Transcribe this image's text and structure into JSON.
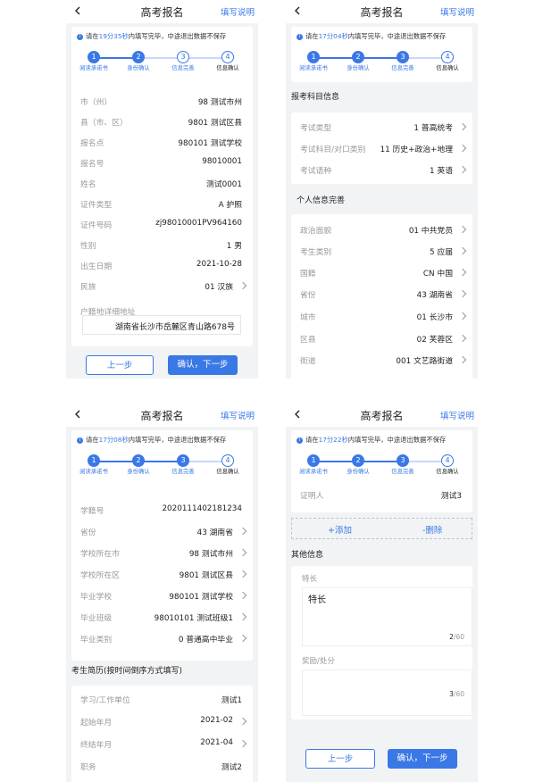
{
  "common": {
    "title": "高考报名",
    "help_link": "填写说明",
    "notice_prefix": "请在",
    "notice_suffix": "内填写完毕，中途退出数据不保存",
    "step_labels": [
      "阅读承诺书",
      "身份确认",
      "信息完善",
      "信息确认"
    ],
    "step_numbers": [
      "1",
      "2",
      "3",
      "4"
    ],
    "prev_button": "上一步",
    "next_button": "确认，下一步",
    "accent_color": "#3a78e6"
  },
  "screen1": {
    "timer": "19分35秒",
    "current_step": 2,
    "rows": [
      {
        "label": "市（州）",
        "value": "98 测试市州"
      },
      {
        "label": "县（市、区）",
        "value": "9801 测试区县"
      },
      {
        "label": "报名点",
        "value": "980101 测试学校"
      },
      {
        "label": "报名号",
        "value": "98010001"
      },
      {
        "label": "姓名",
        "value": "测试0001"
      },
      {
        "label": "证件类型",
        "value": "A 护照"
      },
      {
        "label": "证件号码",
        "value": "zj98010001PV964160"
      },
      {
        "label": "性别",
        "value": "1 男"
      },
      {
        "label": "出生日期",
        "value": "2021-10-28"
      },
      {
        "label": "民族",
        "value": "01 汉族"
      }
    ],
    "address_label": "户籍地详细地址",
    "address_value": "湖南省长沙市岳麓区青山路678号"
  },
  "screen2": {
    "timer": "17分04秒",
    "current_step": 3,
    "section_subjects": "报考科目信息",
    "subject_rows": [
      {
        "label": "考试类型",
        "value": "1 普高统考"
      },
      {
        "label": "考试科目/对口类别",
        "value": "11 历史+政治+地理"
      },
      {
        "label": "考试语种",
        "value": "1 英语"
      }
    ],
    "section_personal": "个人信息完善",
    "personal_rows": [
      {
        "label": "政治面貌",
        "value": "01 中共党员"
      },
      {
        "label": "考生类别",
        "value": "5 应届"
      },
      {
        "label": "国籍",
        "value": "CN 中国"
      },
      {
        "label": "省份",
        "value": "43 湖南省"
      },
      {
        "label": "城市",
        "value": "01 长沙市"
      },
      {
        "label": "区县",
        "value": "02 芙蓉区"
      },
      {
        "label": "街道",
        "value": "001 文艺路街道"
      }
    ]
  },
  "screen3": {
    "timer": "17分08秒",
    "current_step": 3,
    "rows": [
      {
        "label": "学籍号",
        "value": "2020111402181234"
      },
      {
        "label": "省份",
        "value": "43 湖南省"
      },
      {
        "label": "学校所在市",
        "value": "98 测试市州"
      },
      {
        "label": "学校所在区",
        "value": "9801 测试区县"
      },
      {
        "label": "毕业学校",
        "value": "980101 测试学校"
      },
      {
        "label": "毕业班级",
        "value": "98010101 测试班级1"
      },
      {
        "label": "毕业类别",
        "value": "0 普通高中毕业"
      }
    ],
    "section_resume": "考生简历(按时间倒序方式填写)",
    "resume_rows": [
      {
        "label": "学习/工作单位",
        "value": "测试1"
      },
      {
        "label": "起始年月",
        "value": "2021-02"
      },
      {
        "label": "终结年月",
        "value": "2021-04"
      },
      {
        "label": "职务",
        "value": "测试2"
      }
    ]
  },
  "screen4": {
    "timer": "17分22秒",
    "current_step": 3,
    "partial_label": "证明人",
    "partial_value": "测试3",
    "add_label": "+添加",
    "delete_label": "-删除",
    "section_other": "其他信息",
    "specialty_label": "特长",
    "specialty_value": "特长",
    "specialty_count": "2",
    "specialty_max": "/60",
    "award_label": "奖励/处分",
    "award_count": "3",
    "award_max": "/60"
  }
}
